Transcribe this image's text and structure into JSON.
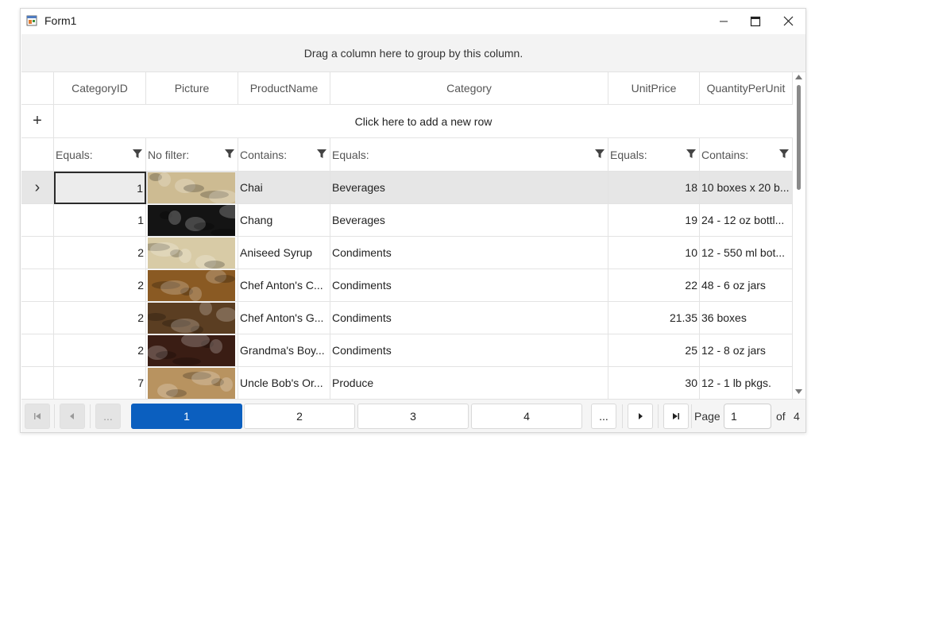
{
  "window": {
    "title": "Form1"
  },
  "group_panel": {
    "text": "Drag a column here to group by this column."
  },
  "columns": [
    {
      "name": "CategoryID"
    },
    {
      "name": "Picture"
    },
    {
      "name": "ProductName"
    },
    {
      "name": "Category"
    },
    {
      "name": "UnitPrice"
    },
    {
      "name": "QuantityPerUnit"
    }
  ],
  "new_row": {
    "plus": "+",
    "text": "Click here to add a new row"
  },
  "filters": [
    "Equals:",
    "No filter:",
    "Contains:",
    "Equals:",
    "Equals:",
    "Contains:"
  ],
  "rows": [
    {
      "indicator": "›",
      "category_id": "1",
      "product_name": "Chai",
      "category": "Beverages",
      "unit_price": "18",
      "quantity_per_unit": "10 boxes x 20 b...",
      "picture": "food-photo"
    },
    {
      "indicator": "",
      "category_id": "1",
      "product_name": "Chang",
      "category": "Beverages",
      "unit_price": "19",
      "quantity_per_unit": "24 - 12 oz bottl...",
      "picture": "food-photo"
    },
    {
      "indicator": "",
      "category_id": "2",
      "product_name": "Aniseed Syrup",
      "category": "Condiments",
      "unit_price": "10",
      "quantity_per_unit": "12 - 550 ml bot...",
      "picture": "food-photo"
    },
    {
      "indicator": "",
      "category_id": "2",
      "product_name": "Chef Anton's C...",
      "category": "Condiments",
      "unit_price": "22",
      "quantity_per_unit": "48 - 6 oz jars",
      "picture": "food-photo"
    },
    {
      "indicator": "",
      "category_id": "2",
      "product_name": "Chef Anton's G...",
      "category": "Condiments",
      "unit_price": "21.35",
      "quantity_per_unit": "36 boxes",
      "picture": "food-photo"
    },
    {
      "indicator": "",
      "category_id": "2",
      "product_name": "Grandma's Boy...",
      "category": "Condiments",
      "unit_price": "25",
      "quantity_per_unit": "12 - 8 oz jars",
      "picture": "food-photo"
    },
    {
      "indicator": "",
      "category_id": "7",
      "product_name": "Uncle Bob's Or...",
      "category": "Produce",
      "unit_price": "30",
      "quantity_per_unit": "12 - 1 lb pkgs.",
      "picture": "food-photo"
    }
  ],
  "pager": {
    "ellipsis": "...",
    "pages": [
      "1",
      "2",
      "3",
      "4"
    ],
    "page_label": "Page",
    "page_value": "1",
    "of_label": "of",
    "total_pages": "4"
  },
  "photo_colors": [
    "#cdbb92",
    "#141414",
    "#d8cba6",
    "#8a5a23",
    "#5b3e22",
    "#3a1d14",
    "#b89360"
  ],
  "colors": {
    "accent": "#0b5fbf",
    "selected_row": "#e6e6e6"
  }
}
